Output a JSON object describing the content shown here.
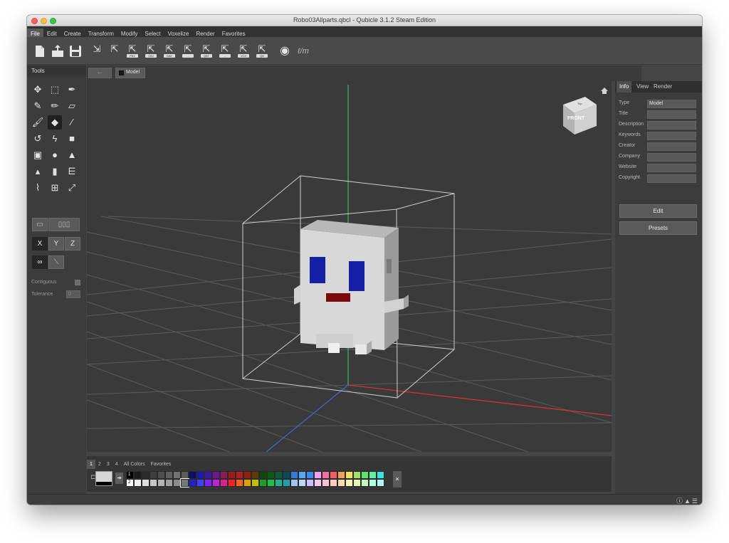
{
  "window": {
    "title": "Robo03Allparts.qbcl - Qubicle 3.1.2 Steam Edition"
  },
  "menu": [
    "File",
    "Edit",
    "Create",
    "Transform",
    "Modify",
    "Select",
    "Voxelize",
    "Render",
    "Favorites"
  ],
  "toolbar": {
    "export_labels": [
      "",
      "",
      "FBX",
      "OBJ",
      "DAE",
      "...",
      "QBT",
      "...",
      "VOX",
      "QB",
      "SCH"
    ]
  },
  "tools_panel": {
    "title": "Tools",
    "axis": {
      "x": "X",
      "y": "Y",
      "z": "Z"
    },
    "contiguous_label": "Contiguous",
    "tolerance_label": "Tolerance",
    "tolerance_value": "0"
  },
  "view": {
    "back_icon": "←",
    "breadcrumb": "Model",
    "nav_cube": {
      "front": "FRONT",
      "top": "Top"
    }
  },
  "right_panel": {
    "tabs": [
      "Info",
      "View",
      "Render"
    ],
    "fields": [
      {
        "label": "Type",
        "value": "Model"
      },
      {
        "label": "Title",
        "value": ""
      },
      {
        "label": "Description",
        "value": ""
      },
      {
        "label": "Keywords",
        "value": ""
      },
      {
        "label": "Creator",
        "value": ""
      },
      {
        "label": "Company",
        "value": ""
      },
      {
        "label": "Website",
        "value": ""
      },
      {
        "label": "Copyright",
        "value": ""
      }
    ],
    "edit_button": "Edit",
    "presets_button": "Presets"
  },
  "palette": {
    "tabs": [
      "1",
      "2",
      "3",
      "4",
      "All Colors",
      "Favorites"
    ],
    "row1": [
      "#000000",
      "#1b1b1b",
      "#2b2b2b",
      "#3d3d3d",
      "#4e4e4e",
      "#606060",
      "#727272",
      "#5c5c5c",
      "#101060",
      "#1a1ab0",
      "#3a1aa0",
      "#6a1a8a",
      "#8a1a5a",
      "#a01818",
      "#b02020",
      "#902010",
      "#603a00",
      "#0c4a0c",
      "#0a5a1a",
      "#105a3a",
      "#0a4a5a",
      "#3a78d8",
      "#58a8f0",
      "#3a8af0",
      "#f0a0f0",
      "#f070a0",
      "#f06060",
      "#f0a060",
      "#f0e060",
      "#a0e060",
      "#60e070",
      "#60f0a0",
      "#40e0e0"
    ],
    "row2": [
      "#ffffff",
      "#f0f0f0",
      "#dcdcdc",
      "#c8c8c8",
      "#b4b4b4",
      "#a0a0a0",
      "#8c8c8c",
      "#787878",
      "#2020d0",
      "#4040ff",
      "#8020ff",
      "#c020e0",
      "#e02090",
      "#ff2020",
      "#ff6020",
      "#e0a000",
      "#c0c000",
      "#20a020",
      "#20c040",
      "#20b090",
      "#20a0b0",
      "#a0c8f0",
      "#b8d8ff",
      "#c8c0ff",
      "#f0c8f0",
      "#ffc0d0",
      "#ffc8c0",
      "#ffd8b0",
      "#fff0b0",
      "#e0f8b0",
      "#c0f8c0",
      "#b0ffe0",
      "#b0f8f8"
    ],
    "slot1_label": "1",
    "slot2_label": "2",
    "close_icon": "×"
  },
  "status": {
    "icons": [
      "info-icon",
      "warning-icon",
      "menu-icon"
    ]
  }
}
